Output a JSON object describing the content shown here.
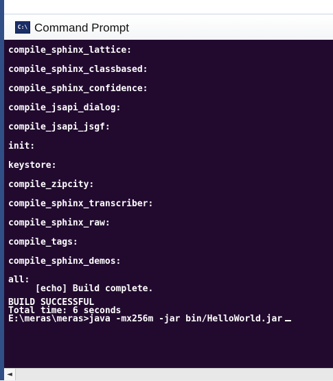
{
  "window": {
    "title": "Command Prompt",
    "icon": "cmd-app-icon",
    "icon_text": "C:\\"
  },
  "console": {
    "background": "#220a2f",
    "text_color": "#ffffff",
    "lines": [
      "compile_sphinx_lattice:",
      "compile_sphinx_classbased:",
      "compile_sphinx_confidence:",
      "compile_jsapi_dialog:",
      "compile_jsapi_jsgf:",
      "init:",
      "keystore:",
      "compile_zipcity:",
      "compile_sphinx_transcriber:",
      "compile_sphinx_raw:",
      "compile_tags:",
      "compile_sphinx_demos:",
      "all:",
      "     [echo] Build complete.",
      "BUILD SUCCESSFUL",
      "Total time: 6 seconds",
      "E:\\meras\\meras>java -mx256m -jar bin/HelloWorld.jar"
    ]
  },
  "scrollbar": {
    "left_arrow": "◄"
  }
}
